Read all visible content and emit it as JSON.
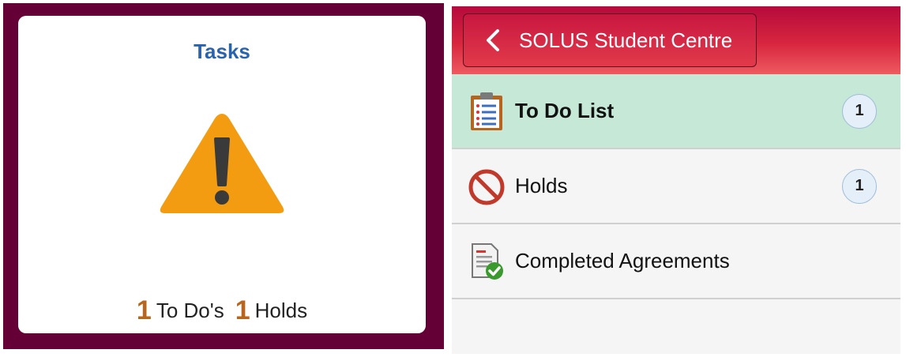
{
  "tasks_tile": {
    "title": "Tasks",
    "todo_count": "1",
    "todo_label": "To Do's",
    "holds_count": "1",
    "holds_label": "Holds",
    "icon": "warning-icon",
    "colors": {
      "frame": "#640036",
      "title": "#2a63ad",
      "count": "#b8651e",
      "warning": "#f39c12"
    }
  },
  "panel": {
    "back_label": "SOLUS Student Centre",
    "items": [
      {
        "label": "To Do List",
        "badge": "1",
        "icon": "clipboard-list-icon",
        "active": true
      },
      {
        "label": "Holds",
        "badge": "1",
        "icon": "no-entry-icon",
        "active": false
      },
      {
        "label": "Completed Agreements",
        "badge": "",
        "icon": "document-check-icon",
        "active": false
      }
    ],
    "colors": {
      "header": "#d8263f",
      "active_row": "#c6e8d6"
    }
  }
}
